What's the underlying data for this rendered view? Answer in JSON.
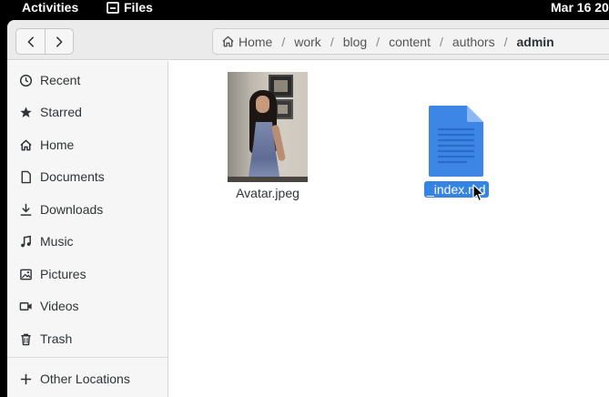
{
  "topbar": {
    "activities": "Activities",
    "app_name": "Files",
    "clock": "Mar 16  20"
  },
  "nav": {
    "back_icon": "chevron-left-icon",
    "forward_icon": "chevron-right-icon"
  },
  "path": {
    "home_icon": "home-icon",
    "crumbs": [
      "Home",
      "work",
      "blog",
      "content",
      "authors",
      "admin"
    ],
    "separator": "/"
  },
  "sidebar": {
    "items": [
      {
        "label": "Recent",
        "icon": "clock-icon"
      },
      {
        "label": "Starred",
        "icon": "star-icon"
      },
      {
        "label": "Home",
        "icon": "home-icon"
      },
      {
        "label": "Documents",
        "icon": "document-icon"
      },
      {
        "label": "Downloads",
        "icon": "download-icon"
      },
      {
        "label": "Music",
        "icon": "music-icon"
      },
      {
        "label": "Pictures",
        "icon": "picture-icon"
      },
      {
        "label": "Videos",
        "icon": "video-icon"
      },
      {
        "label": "Trash",
        "icon": "trash-icon"
      }
    ],
    "other_locations": {
      "label": "Other Locations",
      "icon": "plus-icon"
    }
  },
  "files": [
    {
      "name": "Avatar.jpeg",
      "icon": "image-thumbnail",
      "selected": false
    },
    {
      "name": "_index.md",
      "icon": "text-document-icon",
      "selected": true
    }
  ],
  "colors": {
    "accent": "#3584e4",
    "doc_icon": "#3d86e6"
  }
}
